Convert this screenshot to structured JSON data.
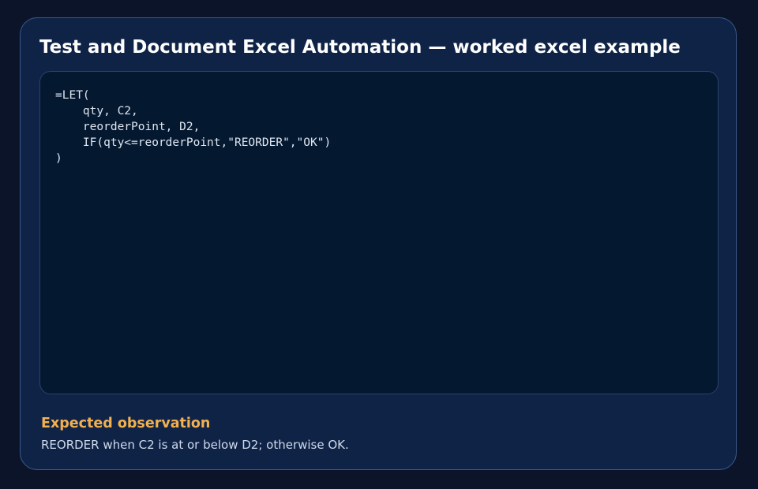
{
  "card": {
    "title": "Test and Document Excel Automation — worked excel example",
    "code": "=LET(\n    qty, C2,\n    reorderPoint, D2,\n    IF(qty<=reorderPoint,\"REORDER\",\"OK\")\n)",
    "observation": {
      "heading": "Expected observation",
      "text": "REORDER when C2 is at or below D2; otherwise OK."
    }
  },
  "colors": {
    "page_background": "#0b1428",
    "card_background": "#0f2347",
    "code_background": "#041830",
    "heading_accent": "#f2b04e",
    "title_text": "#ffffff"
  }
}
